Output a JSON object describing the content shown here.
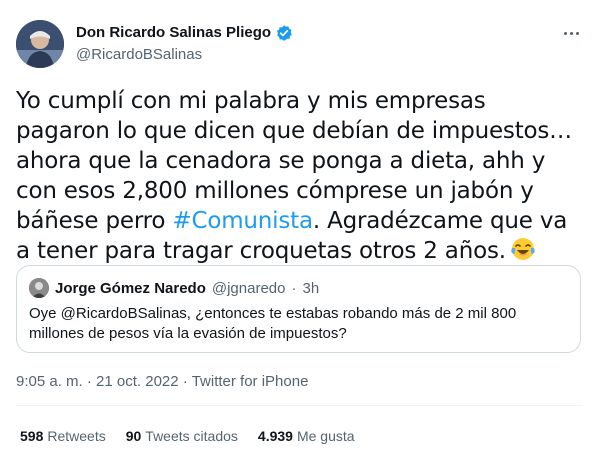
{
  "author": {
    "display_name": "Don Ricardo Salinas Pliego",
    "handle": "@RicardoBSalinas",
    "verified": true
  },
  "tweet": {
    "text_before": "Yo cumplí con mi palabra y mis empresas pagaron lo que dicen que debían de impuestos… ahora que la cenadora se ponga a dieta, ahh y con esos 2,800 millones cómprese un jabón y báñese perro ",
    "hashtag": "#Comunista",
    "text_after": ". Agradézcame que va a tener para tragar croquetas otros 2 años.",
    "emoji": "face-with-tears-of-joy"
  },
  "quote": {
    "name": "Jorge Gómez Naredo",
    "handle": "@jgnaredo",
    "separator": "·",
    "time": "3h",
    "text": "Oye @RicardoBSalinas, ¿entonces te estabas robando más de 2 mil 800 millones de pesos vía la evasión de impuestos?"
  },
  "meta": {
    "time": "9:05 a. m.",
    "sep": "·",
    "date": "21 oct. 2022",
    "source": "Twitter for iPhone"
  },
  "stats": {
    "retweets_count": "598",
    "retweets_label": "Retweets",
    "quotes_count": "90",
    "quotes_label": "Tweets citados",
    "likes_count": "4.939",
    "likes_label": "Me gusta"
  },
  "colors": {
    "accent": "#1d9bf0",
    "secondary_text": "#536471",
    "border": "#cfd9de"
  }
}
